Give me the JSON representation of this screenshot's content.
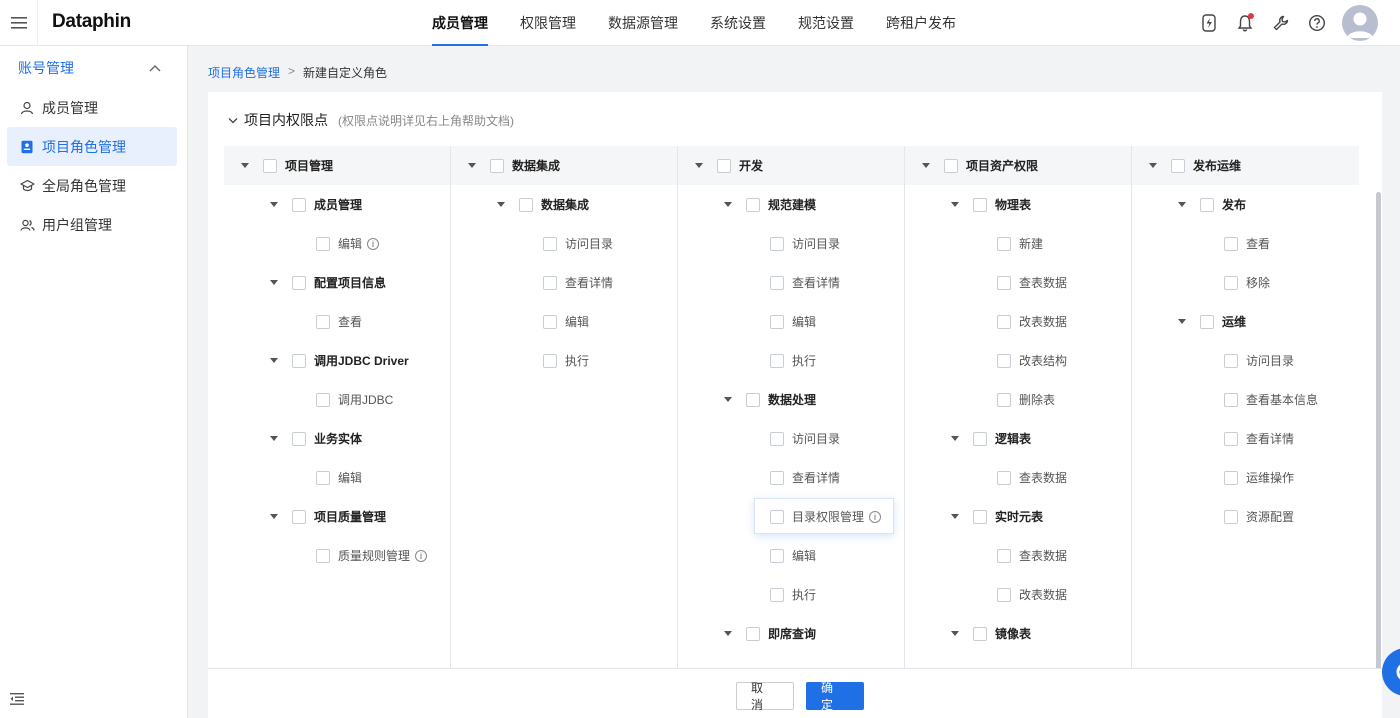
{
  "header": {
    "logo": "Dataphin",
    "nav": [
      {
        "label": "成员管理",
        "active": true
      },
      {
        "label": "权限管理"
      },
      {
        "label": "数据源管理"
      },
      {
        "label": "系统设置"
      },
      {
        "label": "规范设置"
      },
      {
        "label": "跨租户发布"
      }
    ],
    "icons": [
      "lightning-icon",
      "bell-icon",
      "wrench-icon",
      "help-icon"
    ],
    "notification_dot": true
  },
  "sidebar": {
    "group": "账号管理",
    "items": [
      {
        "label": "成员管理",
        "icon": "user-icon"
      },
      {
        "label": "项目角色管理",
        "icon": "role-card-icon",
        "active": true
      },
      {
        "label": "全局角色管理",
        "icon": "graduation-cap-icon"
      },
      {
        "label": "用户组管理",
        "icon": "user-group-icon"
      }
    ]
  },
  "breadcrumb": {
    "parent": "项目角色管理",
    "sep": ">",
    "current": "新建自定义角色"
  },
  "section": {
    "title": "项目内权限点",
    "hint": "(权限点说明详见右上角帮助文档)"
  },
  "columns": [
    {
      "title": "项目管理",
      "groups": [
        {
          "label": "成员管理",
          "items": [
            {
              "label": "编辑",
              "info": true
            }
          ]
        },
        {
          "label": "配置项目信息",
          "items": [
            {
              "label": "查看"
            }
          ]
        },
        {
          "label": "调用JDBC Driver",
          "items": [
            {
              "label": "调用JDBC"
            }
          ]
        },
        {
          "label": "业务实体",
          "items": [
            {
              "label": "编辑"
            }
          ]
        },
        {
          "label": "项目质量管理",
          "items": [
            {
              "label": "质量规则管理",
              "info": true
            }
          ]
        }
      ]
    },
    {
      "title": "数据集成",
      "groups": [
        {
          "label": "数据集成",
          "items": [
            {
              "label": "访问目录"
            },
            {
              "label": "查看详情"
            },
            {
              "label": "编辑"
            },
            {
              "label": "执行"
            }
          ]
        }
      ]
    },
    {
      "title": "开发",
      "groups": [
        {
          "label": "规范建模",
          "items": [
            {
              "label": "访问目录"
            },
            {
              "label": "查看详情"
            },
            {
              "label": "编辑"
            },
            {
              "label": "执行"
            }
          ]
        },
        {
          "label": "数据处理",
          "items": [
            {
              "label": "访问目录"
            },
            {
              "label": "查看详情"
            },
            {
              "label": "目录权限管理",
              "info": true,
              "highlight": true
            },
            {
              "label": "编辑"
            },
            {
              "label": "执行"
            }
          ]
        },
        {
          "label": "即席查询",
          "items": []
        }
      ]
    },
    {
      "title": "项目资产权限",
      "groups": [
        {
          "label": "物理表",
          "items": [
            {
              "label": "新建"
            },
            {
              "label": "查表数据"
            },
            {
              "label": "改表数据"
            },
            {
              "label": "改表结构"
            },
            {
              "label": "删除表"
            }
          ]
        },
        {
          "label": "逻辑表",
          "items": [
            {
              "label": "查表数据"
            }
          ]
        },
        {
          "label": "实时元表",
          "items": [
            {
              "label": "查表数据"
            },
            {
              "label": "改表数据"
            }
          ]
        },
        {
          "label": "镜像表",
          "items": []
        }
      ]
    },
    {
      "title": "发布运维",
      "groups": [
        {
          "label": "发布",
          "items": [
            {
              "label": "查看"
            },
            {
              "label": "移除"
            }
          ]
        },
        {
          "label": "运维",
          "items": [
            {
              "label": "访问目录"
            },
            {
              "label": "查看基本信息"
            },
            {
              "label": "查看详情"
            },
            {
              "label": "运维操作"
            },
            {
              "label": "资源配置"
            }
          ]
        }
      ]
    }
  ],
  "footer": {
    "cancel": "取消",
    "ok": "确定"
  }
}
